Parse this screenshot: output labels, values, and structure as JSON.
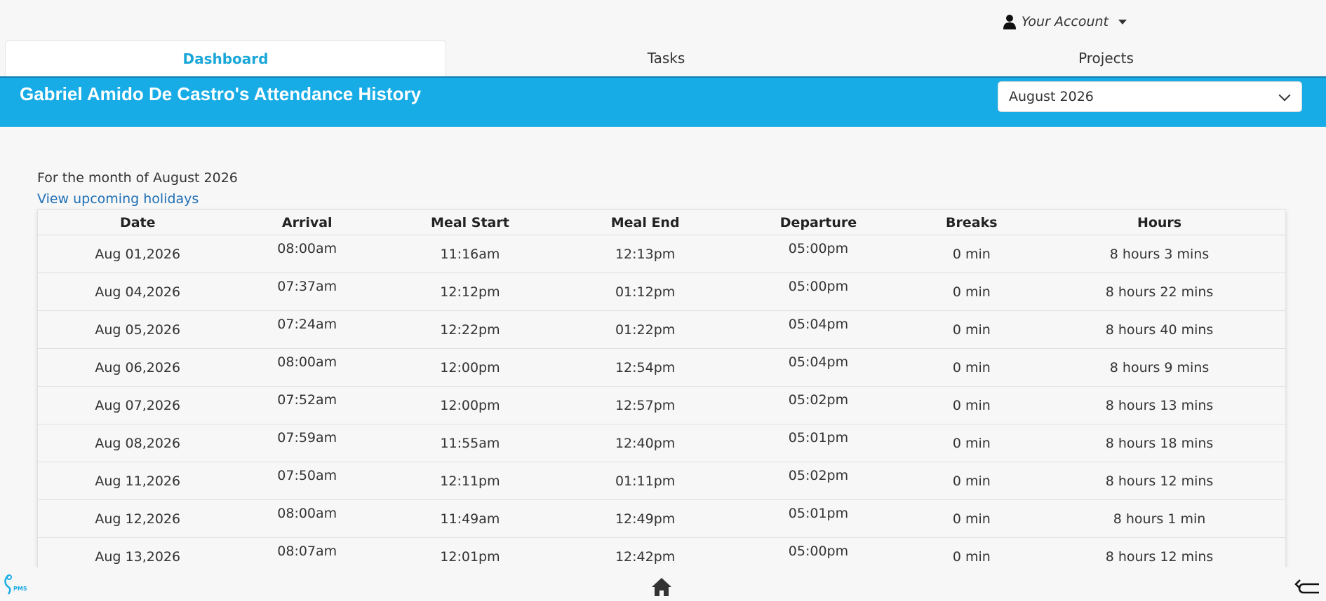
{
  "header": {
    "account_label": "Your Account",
    "tabs": [
      {
        "label": "Dashboard",
        "active": true
      },
      {
        "label": "Tasks",
        "active": false
      },
      {
        "label": "Projects",
        "active": false
      }
    ]
  },
  "banner": {
    "title": "Gabriel Amido De Castro's Attendance History",
    "month_select": "August 2026",
    "color": "#17ace6"
  },
  "summary": {
    "month_text": "For the month of August 2026",
    "holidays_link": "View upcoming holidays"
  },
  "table": {
    "columns": [
      "Date",
      "Arrival",
      "Meal Start",
      "Meal End",
      "Departure",
      "Breaks",
      "Hours"
    ],
    "rows": [
      [
        "Aug 01,2026",
        "08:00am",
        "11:16am",
        "12:13pm",
        "05:00pm",
        "0 min",
        "8 hours 3 mins"
      ],
      [
        "Aug 04,2026",
        "07:37am",
        "12:12pm",
        "01:12pm",
        "05:00pm",
        "0 min",
        "8 hours 22 mins"
      ],
      [
        "Aug 05,2026",
        "07:24am",
        "12:22pm",
        "01:22pm",
        "05:04pm",
        "0 min",
        "8 hours 40 mins"
      ],
      [
        "Aug 06,2026",
        "08:00am",
        "12:00pm",
        "12:54pm",
        "05:04pm",
        "0 min",
        "8 hours 9 mins"
      ],
      [
        "Aug 07,2026",
        "07:52am",
        "12:00pm",
        "12:57pm",
        "05:02pm",
        "0 min",
        "8 hours 13 mins"
      ],
      [
        "Aug 08,2026",
        "07:59am",
        "11:55am",
        "12:40pm",
        "05:01pm",
        "0 min",
        "8 hours 18 mins"
      ],
      [
        "Aug 11,2026",
        "07:50am",
        "12:11pm",
        "01:11pm",
        "05:02pm",
        "0 min",
        "8 hours 12 mins"
      ],
      [
        "Aug 12,2026",
        "08:00am",
        "11:49am",
        "12:49pm",
        "05:01pm",
        "0 min",
        "8 hours 1 min"
      ],
      [
        "Aug 13,2026",
        "08:07am",
        "12:01pm",
        "12:42pm",
        "05:00pm",
        "0 min",
        "8 hours 12 mins"
      ]
    ]
  },
  "footer": {
    "logo_text": "PMS",
    "icons": [
      "pms-logo-icon",
      "home-icon",
      "back-arrow-icon"
    ]
  }
}
